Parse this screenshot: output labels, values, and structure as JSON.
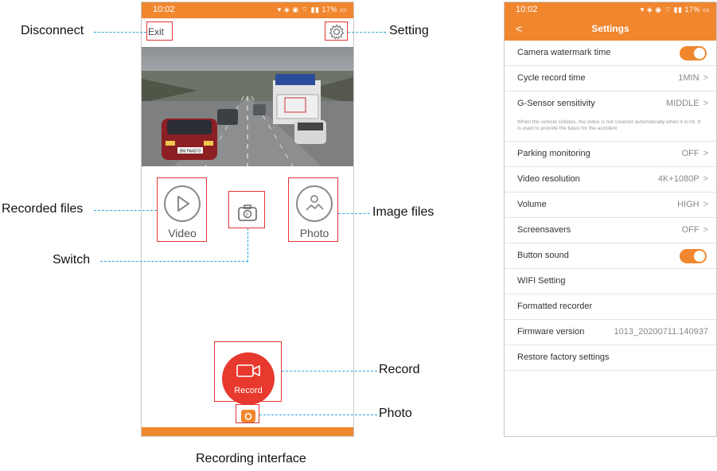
{
  "left_phone": {
    "status_time": "10:02",
    "status_battery": "17%",
    "exit_label": "Exit",
    "video_label": "Video",
    "photo_label": "Photo",
    "record_label": "Record",
    "plate_text": "BM PA4573"
  },
  "annotations": {
    "disconnect": "Disconnect",
    "setting": "Setting",
    "recorded_files": "Recorded files",
    "image_files": "Image files",
    "switch": "Switch",
    "record": "Record",
    "photo": "Photo",
    "caption": "Recording interface"
  },
  "settings": {
    "status_time": "10:02",
    "status_battery": "17%",
    "back": "<",
    "title": "Settings",
    "items": [
      {
        "label": "Camera watermark time",
        "toggle": true
      },
      {
        "label": "Cycle record time",
        "value": "1MIN"
      },
      {
        "label": "G-Sensor sensitivity",
        "value": "MIDDLE"
      },
      {
        "label": "Parking monitoring",
        "value": "OFF"
      },
      {
        "label": "Video resolution",
        "value": "4K+1080P"
      },
      {
        "label": "Volume",
        "value": "HIGH"
      },
      {
        "label": "Screensavers",
        "value": "OFF"
      },
      {
        "label": "Button sound",
        "toggle": true
      },
      {
        "label": "WIFI Setting"
      },
      {
        "label": "Formatted recorder"
      },
      {
        "label": "Firmware version",
        "value": "1013_20200711.140937"
      },
      {
        "label": "Restore factory settings"
      }
    ],
    "gsensor_note": "When the vehicle collides, the video is not covered automatically when it is hit. It is used to provide the basis for the accident",
    "chevron": ">"
  },
  "colors": {
    "accent_orange": "#f0872f",
    "record_red": "#e8392f",
    "annotation_box": "#e23434",
    "annotation_line": "#2aa7e0"
  },
  "icons": [
    "gear-icon",
    "play-icon",
    "image-icon",
    "camera-switch-icon",
    "video-camera-icon",
    "camera-icon",
    "chevron-right-icon",
    "back-chevron-icon"
  ]
}
